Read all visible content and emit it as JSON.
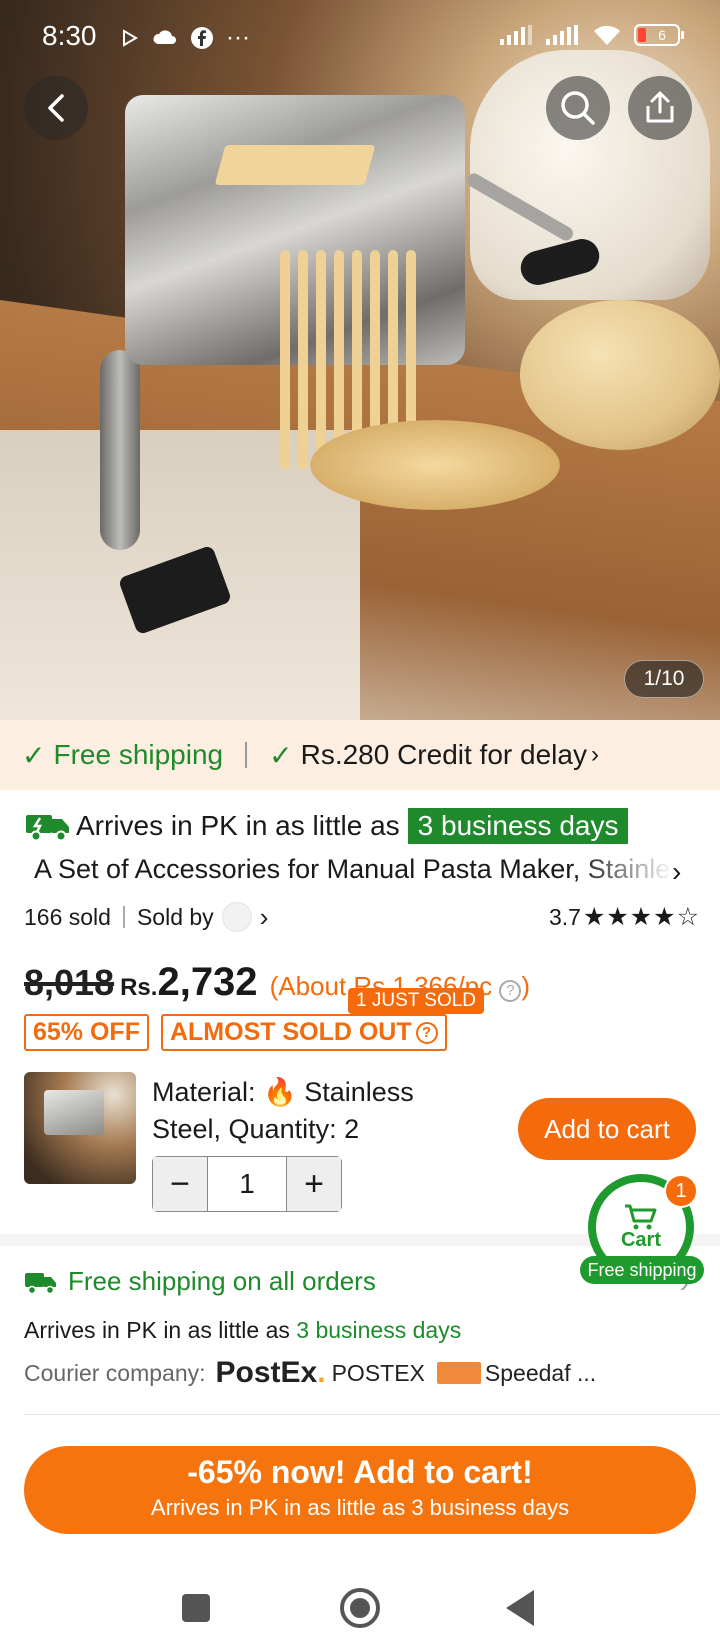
{
  "status_bar": {
    "time": "8:30",
    "battery": "6",
    "dots": "···"
  },
  "hero": {
    "page_counter": "1/10"
  },
  "promo": {
    "free_shipping": "Free shipping",
    "credit": "Rs.280 Credit for delay"
  },
  "arrival": {
    "prefix": "Arrives in PK in as little as",
    "badge": "3 business days"
  },
  "product": {
    "title": "A Set of Accessories for Manual Pasta Maker, Stainless Steel",
    "sold": "166 sold",
    "sold_by": "Sold by",
    "rating": "3.7",
    "rating_value": 3.7,
    "stars": "★★★★☆",
    "original_price": "8,018",
    "currency": "Rs.",
    "price": "2,732",
    "per_piece": "(About Rs.1,366/pc",
    "per_piece_close": ")",
    "just_sold": "1 JUST SOLD",
    "discount_tag": "65% OFF",
    "stock_tag": "ALMOST SOLD OUT"
  },
  "variant": {
    "label_prefix": "Material:",
    "label_rest": "Stainless Steel, Quantity: 2",
    "quantity": "1",
    "minus": "−",
    "plus": "+",
    "add_to_cart": "Add to cart"
  },
  "cart_float": {
    "label": "Cart",
    "count": "1",
    "free_shipping": "Free shipping"
  },
  "shipping": {
    "header": "Free shipping on all orders",
    "arrives_prefix": "Arrives in PK in as little as",
    "arrives_days": "3 business days",
    "courier_label": "Courier company:",
    "courier1_logo": "PostEx",
    "courier1_dot": ".",
    "courier1": "POSTEX",
    "courier2": "Speedaf ..."
  },
  "cta": {
    "main": "-65% now! Add to cart!",
    "sub": "Arrives in PK in as little as 3 business days"
  },
  "colors": {
    "accent": "#f56b0c",
    "green": "#1f8a2b",
    "promo_bg": "#fdeee2"
  }
}
